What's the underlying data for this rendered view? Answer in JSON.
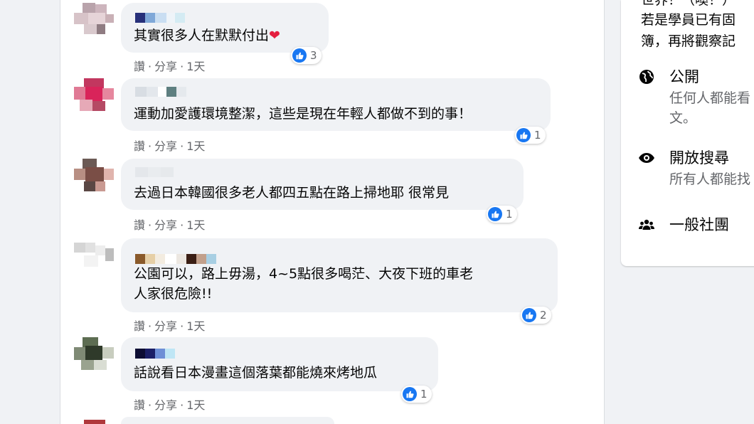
{
  "comments": [
    {
      "text": "其實很多人在默默付出",
      "emoji": "❤",
      "reaction_count": "3",
      "actions": {
        "like": "讚",
        "sep": "·",
        "share": "分享",
        "time": "1天"
      }
    },
    {
      "text": "運動加愛護環境整潔，這些是現在年輕人都做不到的事！",
      "reaction_count": "1",
      "actions": {
        "like": "讚",
        "sep": "·",
        "share": "分享",
        "time": "1天"
      }
    },
    {
      "text": "去過日本韓國很多老人都四五點在路上掃地耶 很常見",
      "reaction_count": "1",
      "actions": {
        "like": "讚",
        "sep": "·",
        "share": "分享",
        "time": "1天"
      }
    },
    {
      "text_line1": "公園可以，路上毋湯，4~5點很多喝茫、大夜下班的車老",
      "text_line2": "人家很危險!!",
      "reaction_count": "2",
      "actions": {
        "like": "讚",
        "sep": "·",
        "share": "分享",
        "time": "1天"
      }
    },
    {
      "text": "話說看日本漫畫這個落葉都能燒來烤地瓜",
      "reaction_count": "1",
      "actions": {
        "like": "讚",
        "sep": "·",
        "share": "分享",
        "time": "1天"
      }
    }
  ],
  "sidebar": {
    "top_line0": "世界！（噢！）",
    "top_line1": "若是學員已有固",
    "top_line2": "簿，再將觀察記",
    "items": [
      {
        "icon": "globe-icon",
        "title": "公開",
        "desc_line1": "任何人都能看",
        "desc_line2": "文。"
      },
      {
        "icon": "eye-icon",
        "title": "開放搜尋",
        "desc_line1": "所有人都能找"
      },
      {
        "icon": "group-icon",
        "title": "一般社團"
      }
    ]
  },
  "colors": {
    "like_blue": "#1877f2",
    "meta_gray": "#65676b",
    "bubble": "#f0f2f5"
  }
}
